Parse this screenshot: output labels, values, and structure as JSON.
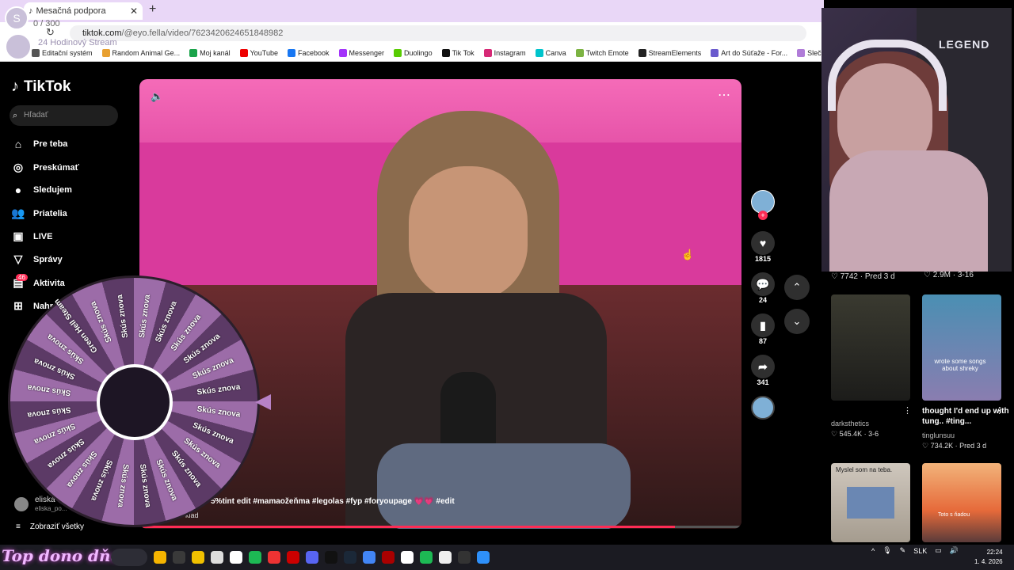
{
  "browser": {
    "tab_title": "Mesačná podpora",
    "url_host": "tiktok.com",
    "url_path": "/@eyo.fella/video/7623420624651848982",
    "bookmarks": [
      "Editační systém",
      "Random Animal Ge...",
      "Moj kanál",
      "YouTube",
      "Facebook",
      "Messenger",
      "Duolingo",
      "Tik Tok",
      "Instagram",
      "Canva",
      "Twitch Emote",
      "StreamElements",
      "Art do Súťaže - For...",
      "Slečna Exis"
    ]
  },
  "stream_overlay": {
    "sub_count": "0 / 300",
    "stream_label": "24 Hodinový Stream",
    "banner": "Top dono dňa -",
    "avatar_letter": "S"
  },
  "sidebar": {
    "logo": "TikTok",
    "search_placeholder": "Hľadať",
    "items": [
      {
        "label": "Pre teba",
        "icon": "⌂"
      },
      {
        "label": "Preskúmať",
        "icon": "◎"
      },
      {
        "label": "Sledujem",
        "icon": "●"
      },
      {
        "label": "Priatelia",
        "icon": "👥"
      },
      {
        "label": "LIVE",
        "icon": "▣"
      },
      {
        "label": "Správy",
        "icon": "▽"
      },
      {
        "label": "Aktivita",
        "icon": "▤"
      },
      {
        "label": "Nahrať",
        "icon": "⊞"
      }
    ],
    "activity_badge": "46",
    "followed_user": "eliska",
    "followed_sub": "eliska_po...",
    "show_all": "Zobraziť všetky"
  },
  "video": {
    "caption": "5%tint edit #mamaožeňma #legolas #fyp #foryoupage 💗💗 #edit",
    "caption_sub": "klad",
    "progress_pct": 89
  },
  "actions": {
    "likes": "1815",
    "comments": "24",
    "saves": "87",
    "shares": "341"
  },
  "webcam": {
    "brand": "LEGEND"
  },
  "right_panel": {
    "top_stats": [
      {
        "text": "♡ 7742 · Pred 3 d"
      },
      {
        "text": "♡ 2.9M · 3-16"
      }
    ],
    "cards": [
      {
        "title": "",
        "user": "darksthetics",
        "stats": "♡ 545.4K · 3-6"
      },
      {
        "title": "thought I'd end up with tung.. #ting...",
        "user": "tinglunsuu",
        "stats": "♡ 734.2K · Pred 3 d"
      },
      {
        "title": "",
        "user": "",
        "stats": ""
      },
      {
        "title": "",
        "user": "",
        "stats": ""
      }
    ],
    "thumb_texts": [
      "wrote some songs about shreky",
      "Myslel som na teba.",
      "Toto s ňadou"
    ]
  },
  "wheel": {
    "labels": [
      "Skús znova",
      "Skús znova",
      "Skús znova",
      "Skús znova",
      "Skús znova",
      "Skús znova",
      "Skús znova",
      "Skús znova",
      "Skús znova",
      "Skús znova",
      "Skús znova",
      "Skús znova",
      "Skús znova",
      "Skús znova",
      "Skús znova",
      "Skús znova",
      "Skús znova",
      "Skús znova",
      "Skús znova",
      "Skús znova",
      "Skús znova",
      "Green Hell Steam",
      "Skús znova",
      "Skús znova"
    ]
  },
  "taskbar": {
    "lang": "SLK",
    "time": "22:24",
    "date": "1. 4. 2026"
  },
  "colors": {
    "accent": "#fe2c55",
    "tab_strip": "#e9d7f7",
    "wheel_a": "#9c6ca8",
    "wheel_b": "#5c3a66"
  }
}
